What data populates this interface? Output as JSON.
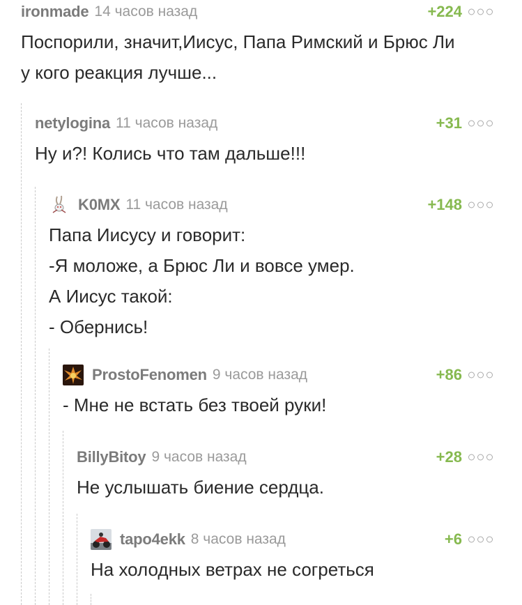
{
  "comments": [
    {
      "author": "ironmade",
      "time": "14 часов назад",
      "rating": "+224",
      "lines": [
        "Поспорили, значит,Иисус, Папа Римский и Брюс Ли",
        "у кого реакция лучше..."
      ]
    },
    {
      "author": "netylogina",
      "time": "11 часов назад",
      "rating": "+31",
      "lines": [
        "Ну и?! Колись что там дальше!!!"
      ]
    },
    {
      "author": "K0MX",
      "time": "11 часов назад",
      "rating": "+148",
      "avatar": "rabbit-avatar",
      "lines": [
        "Папа Иисусу и говорит:",
        "-Я моложе, а Брюс Ли и вовсе умер.",
        "А Иисус такой:",
        "- Обернись!"
      ]
    },
    {
      "author": "ProstoFenomen",
      "time": "9 часов назад",
      "rating": "+86",
      "avatar": "fire-avatar",
      "lines": [
        "- Мне не встать без твоей руки!"
      ]
    },
    {
      "author": "BillyBitoy",
      "time": "9 часов назад",
      "rating": "+28",
      "lines": [
        "Не услышать биение сердца."
      ]
    },
    {
      "author": "tapo4ekk",
      "time": "8 часов назад",
      "rating": "+6",
      "avatar": "motorcycle-avatar",
      "lines": [
        "На холодных ветрах не согреться"
      ]
    }
  ],
  "icons": {
    "more": "more-options-icon"
  },
  "colors": {
    "rating": "#86b94f",
    "author": "#7b7b7b",
    "time": "#9a9a9a",
    "text": "#2a2a2a"
  }
}
